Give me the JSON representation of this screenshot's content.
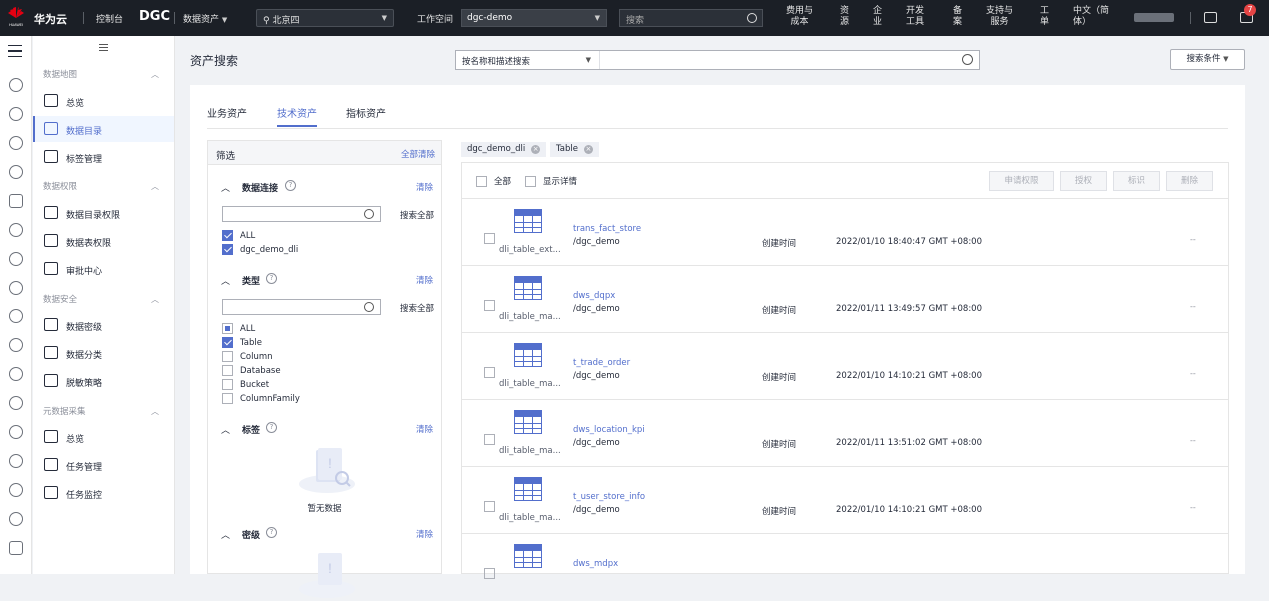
{
  "topbar": {
    "brand": "华为云",
    "console": "控制台",
    "product": "DGC",
    "module": "数据资产",
    "region": "北京四",
    "workspace_label": "工作空间",
    "workspace": "dgc-demo",
    "search_placeholder": "搜索",
    "nav": [
      {
        "l1": "费用与",
        "l2": "成本"
      },
      {
        "l1": "资",
        "l2": "源"
      },
      {
        "l1": "企",
        "l2": "业"
      },
      {
        "l1": "开发",
        "l2": "工具"
      },
      {
        "l1": "备",
        "l2": "案"
      },
      {
        "l1": "支持与",
        "l2": "服务"
      },
      {
        "l1": "工",
        "l2": "单"
      },
      {
        "l1": "中文（简",
        "l2": "体）"
      }
    ],
    "notification_count": "7"
  },
  "sidebar": {
    "groups": [
      {
        "label": "数据地图"
      },
      {
        "label": "数据权限"
      },
      {
        "label": "数据安全"
      },
      {
        "label": "元数据采集"
      }
    ],
    "items": [
      {
        "label": "总览"
      },
      {
        "label": "数据目录"
      },
      {
        "label": "标签管理"
      },
      {
        "label": "数据目录权限"
      },
      {
        "label": "数据表权限"
      },
      {
        "label": "审批中心"
      },
      {
        "label": "数据密级"
      },
      {
        "label": "数据分类"
      },
      {
        "label": "脱敏策略"
      },
      {
        "label": "总览"
      },
      {
        "label": "任务管理"
      },
      {
        "label": "任务监控"
      }
    ]
  },
  "main": {
    "title": "资产搜索",
    "search_type": "按名称和描述搜索",
    "search_conditions": "搜索条件",
    "tabs": [
      {
        "label": "业务资产"
      },
      {
        "label": "技术资产"
      },
      {
        "label": "指标资产"
      }
    ]
  },
  "filter": {
    "title": "筛选",
    "clear_all": "全部清除",
    "clear": "清除",
    "search_all": "搜索全部",
    "empty_text": "暂无数据",
    "sections": {
      "connection": {
        "title": "数据连接",
        "options": [
          "ALL",
          "dgc_demo_dli"
        ]
      },
      "type": {
        "title": "类型",
        "options": [
          "ALL",
          "Table",
          "Column",
          "Database",
          "Bucket",
          "ColumnFamily"
        ]
      },
      "tag": {
        "title": "标签"
      },
      "secret": {
        "title": "密级"
      }
    }
  },
  "selected_tags": [
    "dgc_demo_dli",
    "Table"
  ],
  "results": {
    "select_all": "全部",
    "show_details": "显示详情",
    "actions": [
      "申请权限",
      "授权",
      "标识",
      "删除"
    ],
    "created_label": "创建时间",
    "rows": [
      {
        "name": "trans_fact_store",
        "db": "/dgc_demo",
        "type": "dli_table_ext...",
        "created": "2022/01/10 18:40:47 GMT +08:00",
        "value": "--"
      },
      {
        "name": "dws_dqpx",
        "db": "/dgc_demo",
        "type": "dli_table_ma...",
        "created": "2022/01/11 13:49:57 GMT +08:00",
        "value": "--"
      },
      {
        "name": "t_trade_order",
        "db": "/dgc_demo",
        "type": "dli_table_ma...",
        "created": "2022/01/10 14:10:21 GMT +08:00",
        "value": "--"
      },
      {
        "name": "dws_location_kpi",
        "db": "/dgc_demo",
        "type": "dli_table_ma...",
        "created": "2022/01/11 13:51:02 GMT +08:00",
        "value": "--"
      },
      {
        "name": "t_user_store_info",
        "db": "/dgc_demo",
        "type": "dli_table_ma...",
        "created": "2022/01/10 14:10:21 GMT +08:00",
        "value": "--"
      },
      {
        "name": "dws_mdpx",
        "db": "",
        "type": "",
        "created": "",
        "value": ""
      }
    ]
  }
}
